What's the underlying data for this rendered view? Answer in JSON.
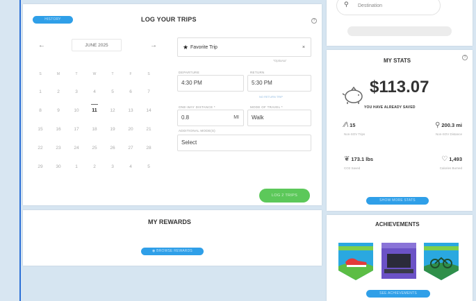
{
  "log": {
    "history_label": "HISTORY",
    "title": "LOG YOUR TRIPS",
    "info": "?",
    "prev": "←",
    "next": "→",
    "month": "JUNE 2025",
    "weekdays": [
      "S",
      "M",
      "T",
      "W",
      "T",
      "F",
      "S"
    ],
    "weeks": [
      [
        "1",
        "2",
        "3",
        "4",
        "5",
        "6",
        "7"
      ],
      [
        "8",
        "9",
        "10",
        "11",
        "12",
        "13",
        "14"
      ],
      [
        "15",
        "16",
        "17",
        "18",
        "19",
        "20",
        "21"
      ],
      [
        "22",
        "23",
        "24",
        "25",
        "26",
        "27",
        "28"
      ],
      [
        "29",
        "30",
        "1",
        "2",
        "3",
        "4",
        "5"
      ]
    ],
    "today": "11",
    "favorite_label": "Favorite Trip",
    "favorite_clear": "×",
    "optional_label": "*Optional",
    "departure_label": "DEPARTURE",
    "departure_value": "4:30 PM",
    "return_label": "RETURN",
    "return_value": "5:30 PM",
    "return_link": "NO RETURN TRIP",
    "distance_label": "ONE-WAY DISTANCE *",
    "distance_value": "0.8",
    "distance_unit": "MI",
    "mode_label": "MODE OF TRAVEL *",
    "mode_value": "Walk",
    "additional_label": "ADDITIONAL MODE(S)",
    "additional_value": "Select",
    "log_button": "LOG 2 TRIPS"
  },
  "rewards": {
    "title": "MY REWARDS",
    "button": "BROWSE REWARDS"
  },
  "destination": {
    "placeholder": "Destination"
  },
  "stats": {
    "title": "MY STATS",
    "info": "?",
    "saved_amount": "$113.07",
    "saved_caption": "YOU HAVE ALREADY SAVED",
    "trips_value": "15",
    "trips_label": "Non-SOV Trips",
    "distance_value": "200.3 mi",
    "distance_label": "Non-SOV Distance",
    "co2_value": "173.1 lbs",
    "co2_label": "CO2 Saved",
    "calories_value": "1,493",
    "calories_label": "Calories Burned",
    "button": "SHOW MORE STATS"
  },
  "achievements": {
    "title": "ACHIEVEMENTS",
    "button": "SEE ACHIEVEMENTS"
  },
  "colors": {
    "accent_blue": "#2f9fe8",
    "log_green": "#5cc85a",
    "background": "#d6e5f1"
  }
}
